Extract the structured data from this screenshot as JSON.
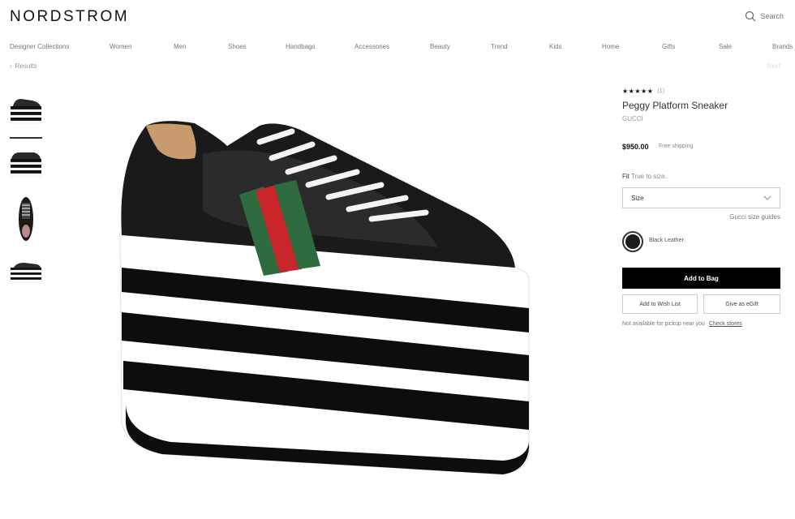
{
  "header": {
    "logo": "NORDSTROM",
    "search_label": "Search"
  },
  "nav": {
    "items": [
      "Designer Collections",
      "Women",
      "Men",
      "Shoes",
      "Handbags",
      "Accessories",
      "Beauty",
      "Trend",
      "Kids",
      "Home",
      "Gifts",
      "Sale",
      "Brands"
    ]
  },
  "breadcrumb": {
    "back_label": "Results",
    "next_label": "Next"
  },
  "product": {
    "stars": "★★★★★",
    "rating_count": "(1)",
    "title": "Peggy Platform Sneaker",
    "brand": "GUCCI",
    "price": "$950.00",
    "shipping": "Free shipping",
    "fit_label": "Fit",
    "fit_value": "True to size.",
    "size_placeholder": "Size",
    "size_guide": "Gucci size guides",
    "color": "Black Leather",
    "add_to_bag": "Add to Bag",
    "wish_list": "Add to Wish List",
    "egift": "Give as eGift",
    "pickup_text": "Not available for pickup near you",
    "check_stores": "Check stores"
  },
  "colors": {
    "black": "#000000",
    "gucci_green": "#2e6b3f",
    "gucci_red": "#c8262a"
  }
}
